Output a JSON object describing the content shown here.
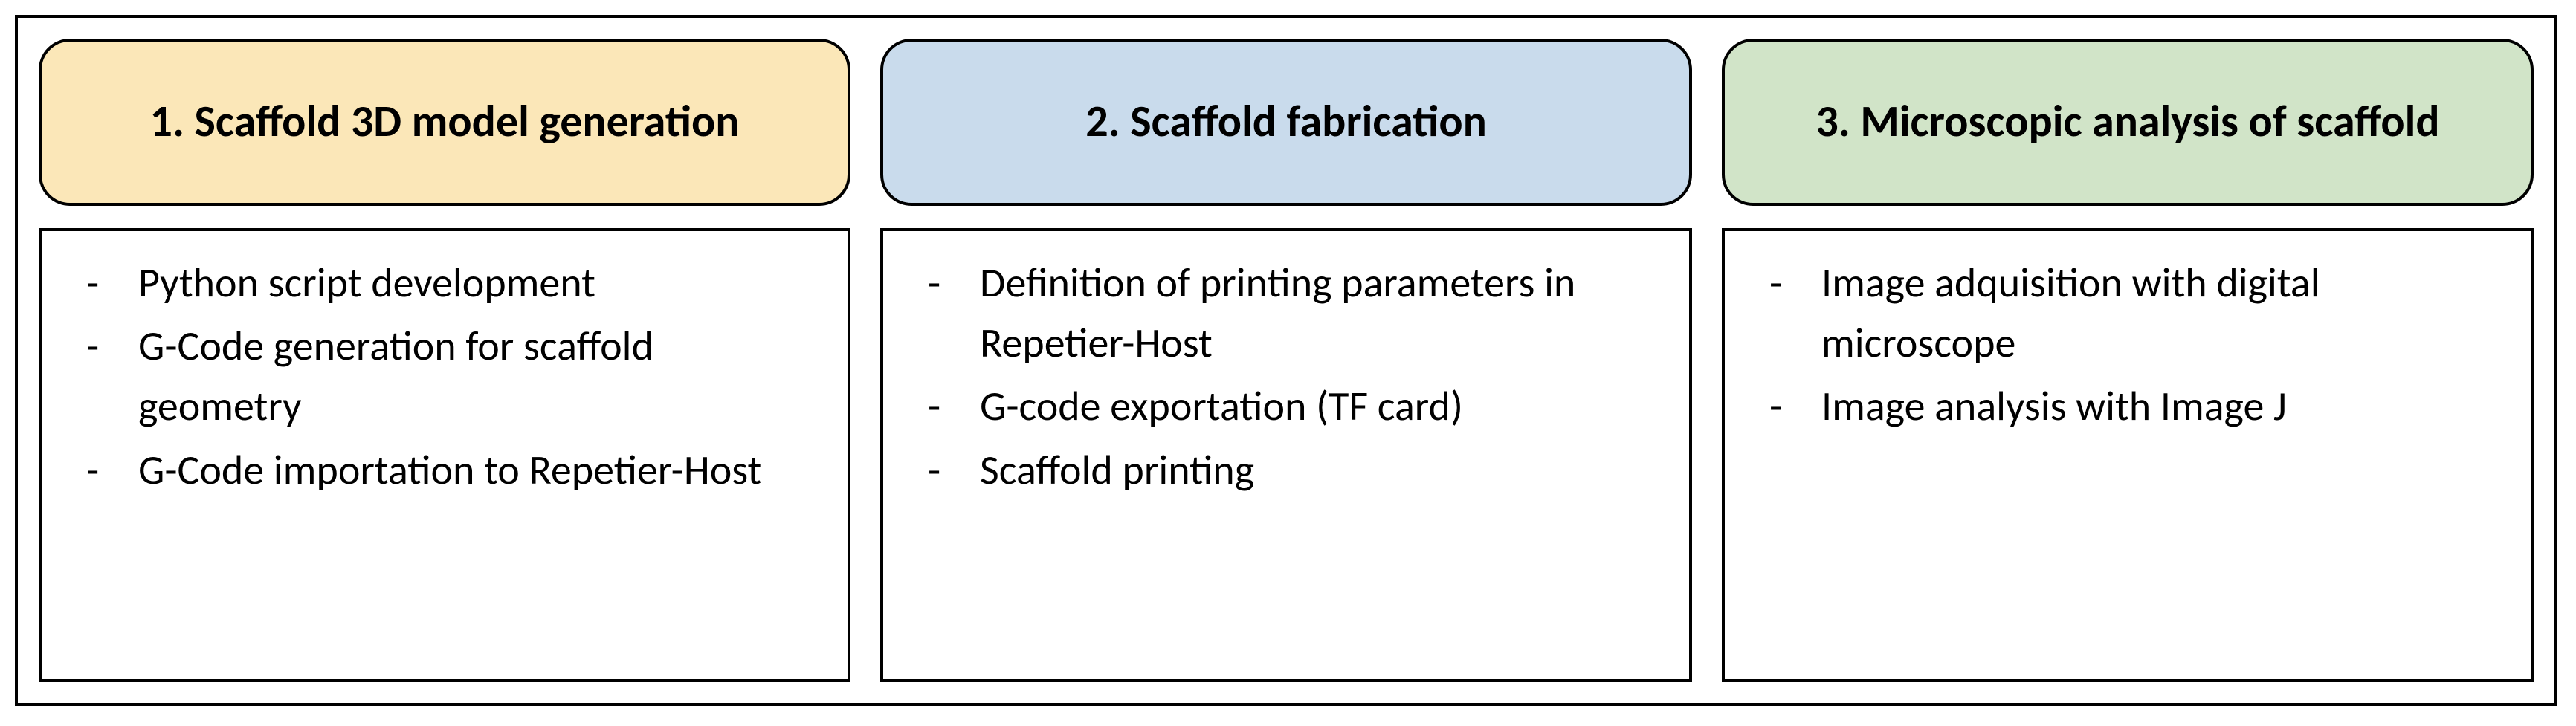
{
  "diagram": {
    "columns": [
      {
        "title": "1. Scaffold 3D model generation",
        "color": "yellow",
        "items": [
          "Python script development",
          "G-Code generation for scaffold geometry",
          "G-Code importation to Repetier-Host"
        ]
      },
      {
        "title": "2. Scaffold fabrication",
        "color": "blue",
        "items": [
          "Definition of printing parameters in Repetier-Host",
          "G-code exportation (TF card)",
          "Scaffold printing"
        ]
      },
      {
        "title": "3. Microscopic analysis of scaffold",
        "color": "green",
        "items": [
          "Image adquisition with digital microscope",
          "Image analysis with Image J"
        ]
      }
    ]
  }
}
